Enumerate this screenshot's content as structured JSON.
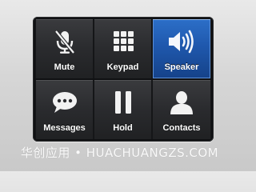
{
  "buttons": [
    {
      "label": "Mute",
      "icon": "microphone-muted-icon",
      "active": false
    },
    {
      "label": "Keypad",
      "icon": "keypad-icon",
      "active": false
    },
    {
      "label": "Speaker",
      "icon": "speaker-icon",
      "active": true
    },
    {
      "label": "Messages",
      "icon": "message-bubble-icon",
      "active": false
    },
    {
      "label": "Hold",
      "icon": "pause-icon",
      "active": false
    },
    {
      "label": "Contacts",
      "icon": "person-icon",
      "active": false
    }
  ],
  "watermark": "华创应用 • HUACHUANGZS.COM",
  "colors": {
    "accent": "#2c6fc8",
    "button_bg": "#2a2b2e",
    "label": "#ffffff"
  }
}
